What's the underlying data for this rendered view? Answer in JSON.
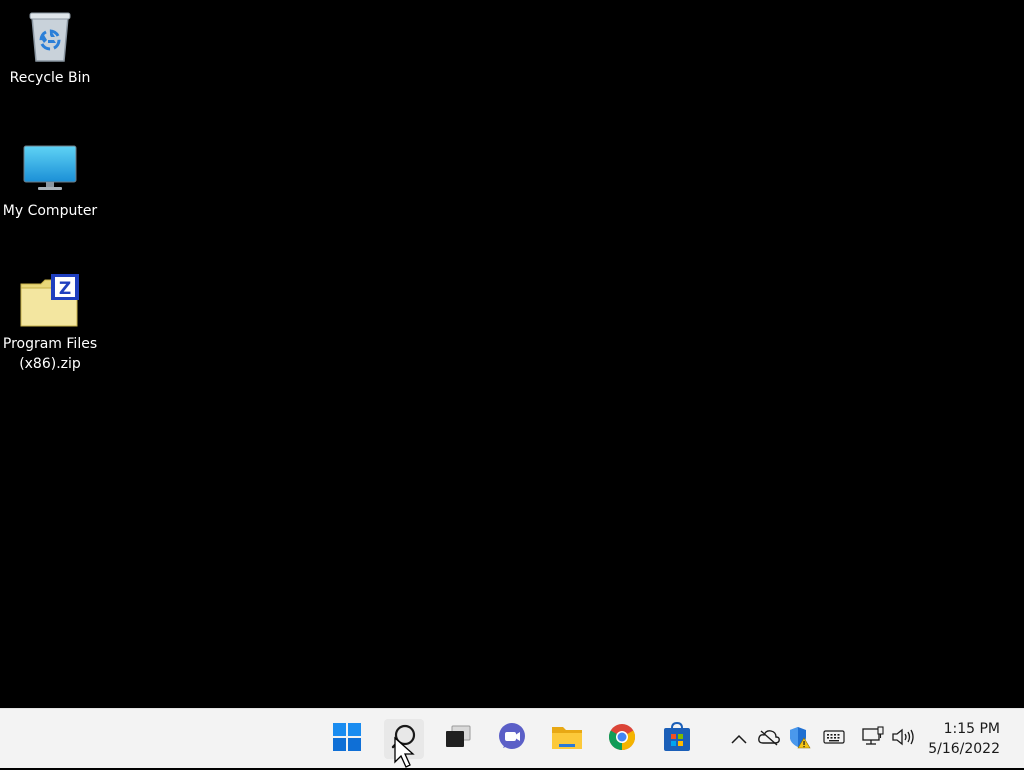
{
  "desktop": {
    "icons": [
      {
        "label": "Recycle Bin",
        "icon": "recycle-bin-icon"
      },
      {
        "label": "My Computer",
        "icon": "monitor-icon"
      },
      {
        "label": "Program Files\n(x86).zip",
        "icon": "zip-folder-icon"
      }
    ]
  },
  "taskbar": {
    "apps": [
      {
        "name": "Start",
        "icon": "windows-start-icon"
      },
      {
        "name": "Search",
        "icon": "search-icon"
      },
      {
        "name": "Task View",
        "icon": "task-view-icon"
      },
      {
        "name": "Chat",
        "icon": "chat-icon"
      },
      {
        "name": "File Explorer",
        "icon": "folder-icon"
      },
      {
        "name": "Google Chrome",
        "icon": "chrome-icon"
      },
      {
        "name": "Microsoft Store",
        "icon": "store-icon"
      }
    ],
    "tray": [
      "chevron-up-icon",
      "onedrive-icon",
      "security-icon",
      "keyboard-icon",
      "network-icon",
      "volume-icon"
    ],
    "clock": {
      "time": "1:15 PM",
      "date": "5/16/2022"
    }
  },
  "colors": {
    "accent": "#0078d4",
    "taskbar_bg": "#f3f3f3",
    "desktop_bg": "#000000"
  }
}
